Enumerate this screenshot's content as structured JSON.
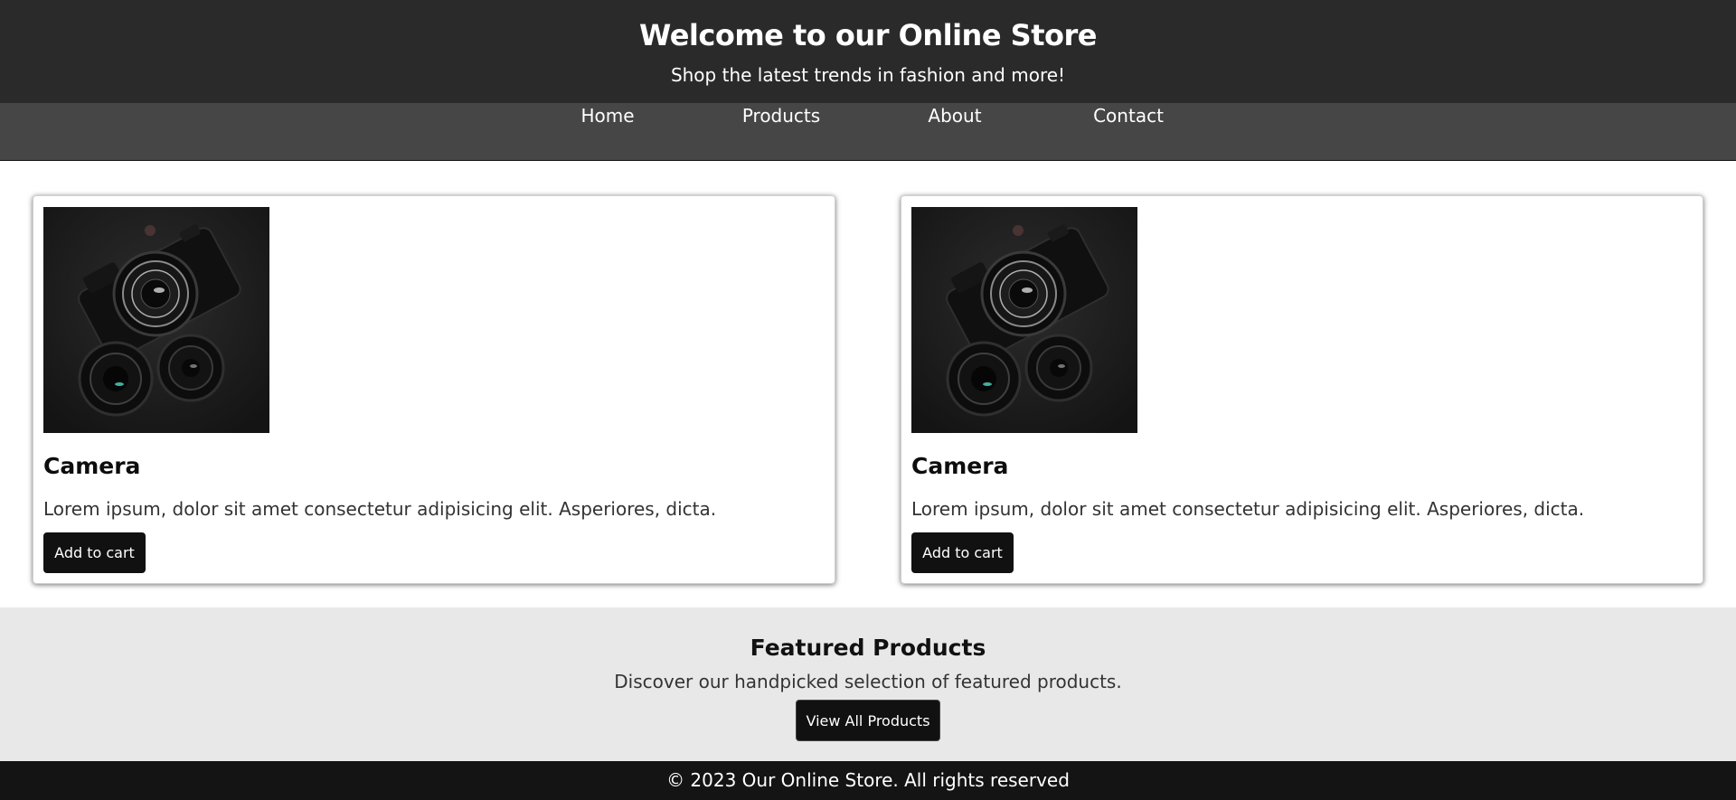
{
  "header": {
    "title": "Welcome to our Online Store",
    "tagline": "Shop the latest trends in fashion and more!"
  },
  "nav": {
    "items": [
      {
        "label": "Home"
      },
      {
        "label": "Products"
      },
      {
        "label": "About"
      },
      {
        "label": "Contact"
      }
    ]
  },
  "products": [
    {
      "image_icon": "camera-image",
      "name": "Camera",
      "description": "Lorem ipsum, dolor sit amet consectetur adipisicing elit. Asperiores, dicta.",
      "button_label": "Add to cart"
    },
    {
      "image_icon": "camera-image",
      "name": "Camera",
      "description": "Lorem ipsum, dolor sit amet consectetur adipisicing elit. Asperiores, dicta.",
      "button_label": "Add to cart"
    }
  ],
  "featured": {
    "title": "Featured Products",
    "description": "Discover our handpicked selection of featured products.",
    "button_label": "View All Products"
  },
  "footer": {
    "copyright": "© 2023 Our Online Store. All rights reserved"
  },
  "colors": {
    "header_bg": "#2a2a2a",
    "nav_bg": "#464646",
    "button_bg": "#111111",
    "featured_bg": "#e8e8e8",
    "footer_bg": "#141414"
  }
}
